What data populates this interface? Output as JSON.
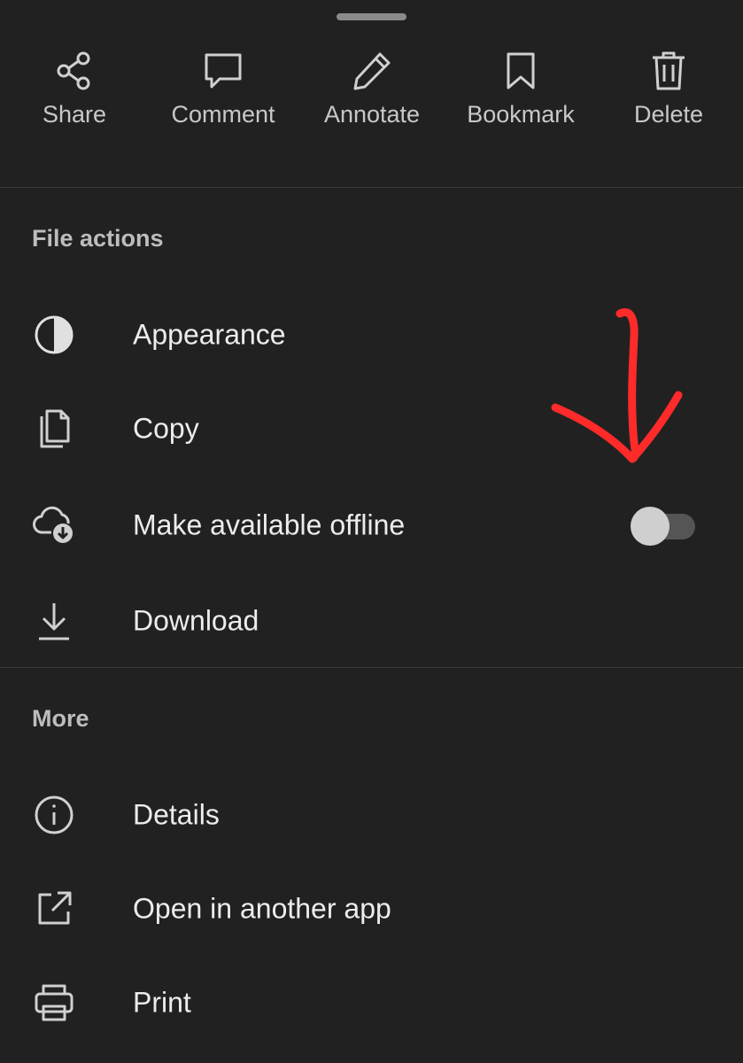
{
  "quick_actions": [
    {
      "label": "Share",
      "icon": "share-icon"
    },
    {
      "label": "Comment",
      "icon": "comment-icon"
    },
    {
      "label": "Annotate",
      "icon": "pencil-icon"
    },
    {
      "label": "Bookmark",
      "icon": "bookmark-icon"
    },
    {
      "label": "Delete",
      "icon": "trash-icon"
    }
  ],
  "file_actions": {
    "title": "File actions",
    "items": [
      {
        "label": "Appearance",
        "icon": "contrast-icon"
      },
      {
        "label": "Copy",
        "icon": "copy-icon"
      },
      {
        "label": "Make available offline",
        "icon": "cloud-download-icon",
        "toggle_on": false
      },
      {
        "label": "Download",
        "icon": "download-icon"
      }
    ]
  },
  "more": {
    "title": "More",
    "items": [
      {
        "label": "Details",
        "icon": "info-icon"
      },
      {
        "label": "Open in another app",
        "icon": "external-link-icon"
      },
      {
        "label": "Print",
        "icon": "printer-icon"
      }
    ]
  },
  "colors": {
    "background": "#212121",
    "text": "#ececec",
    "section_title": "#bdbdbd",
    "icon": "#d0d0d0",
    "toggle_track": "#555555",
    "toggle_thumb": "#cfcfcf",
    "annotation_arrow": "#ff2a2a"
  }
}
